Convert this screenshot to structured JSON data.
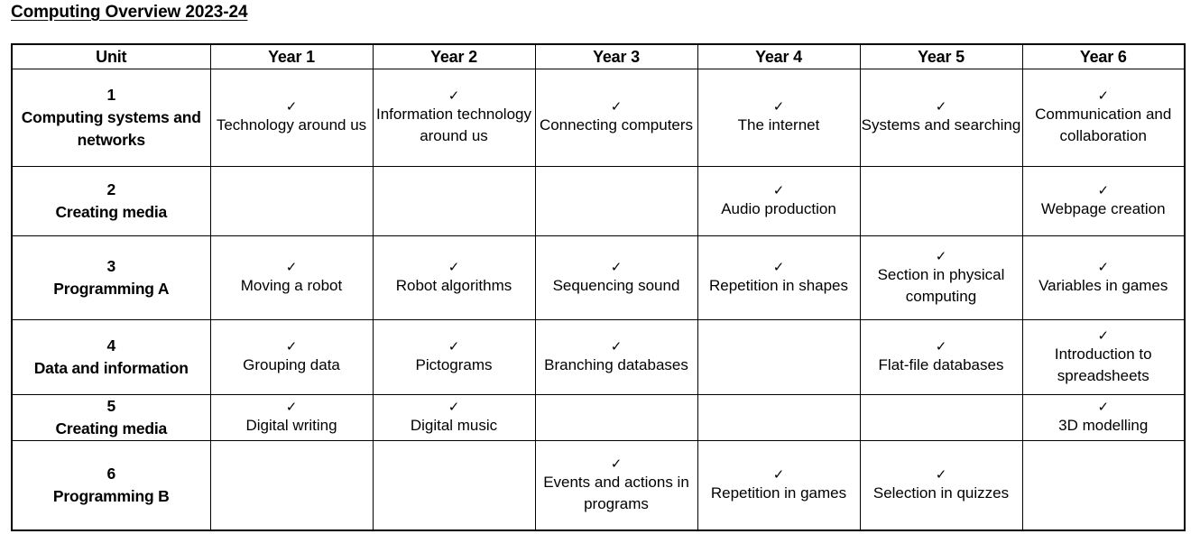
{
  "document": {
    "title": "Computing Overview 2023-24"
  },
  "table": {
    "headers": [
      "Unit",
      "Year 1",
      "Year 2",
      "Year 3",
      "Year 4",
      "Year 5",
      "Year 6"
    ],
    "tick_glyph": "✓",
    "rows": [
      {
        "unit_number": "1",
        "unit_name": "Computing systems and networks",
        "cells": [
          {
            "ticked": true,
            "text": "Technology around us"
          },
          {
            "ticked": true,
            "text": "Information technology around us"
          },
          {
            "ticked": true,
            "text": "Connecting computers"
          },
          {
            "ticked": true,
            "text": "The internet"
          },
          {
            "ticked": true,
            "text": "Systems and searching"
          },
          {
            "ticked": true,
            "text": "Communication and collaboration"
          }
        ]
      },
      {
        "unit_number": "2",
        "unit_name": "Creating media",
        "cells": [
          {
            "ticked": false,
            "text": ""
          },
          {
            "ticked": false,
            "text": ""
          },
          {
            "ticked": false,
            "text": ""
          },
          {
            "ticked": true,
            "text": "Audio production"
          },
          {
            "ticked": false,
            "text": ""
          },
          {
            "ticked": true,
            "text": "Webpage creation"
          }
        ]
      },
      {
        "unit_number": "3",
        "unit_name": "Programming A",
        "cells": [
          {
            "ticked": true,
            "text": "Moving a robot"
          },
          {
            "ticked": true,
            "text": "Robot algorithms"
          },
          {
            "ticked": true,
            "text": "Sequencing sound"
          },
          {
            "ticked": true,
            "text": "Repetition in shapes"
          },
          {
            "ticked": true,
            "text": "Section in physical computing"
          },
          {
            "ticked": true,
            "text": "Variables in games"
          }
        ]
      },
      {
        "unit_number": "4",
        "unit_name": "Data and information",
        "cells": [
          {
            "ticked": true,
            "text": "Grouping data"
          },
          {
            "ticked": true,
            "text": "Pictograms"
          },
          {
            "ticked": true,
            "text": "Branching databases"
          },
          {
            "ticked": false,
            "text": ""
          },
          {
            "ticked": true,
            "text": "Flat-file databases"
          },
          {
            "ticked": true,
            "text": "Introduction to spreadsheets"
          }
        ]
      },
      {
        "unit_number": "5",
        "unit_name": "Creating media",
        "cells": [
          {
            "ticked": true,
            "text": "Digital writing"
          },
          {
            "ticked": true,
            "text": "Digital music"
          },
          {
            "ticked": false,
            "text": ""
          },
          {
            "ticked": false,
            "text": ""
          },
          {
            "ticked": false,
            "text": ""
          },
          {
            "ticked": true,
            "text": "3D modelling"
          }
        ]
      },
      {
        "unit_number": "6",
        "unit_name": "Programming B",
        "cells": [
          {
            "ticked": false,
            "text": ""
          },
          {
            "ticked": false,
            "text": ""
          },
          {
            "ticked": true,
            "text": "Events and actions in programs"
          },
          {
            "ticked": true,
            "text": "Repetition in games"
          },
          {
            "ticked": true,
            "text": "Selection in quizzes"
          },
          {
            "ticked": false,
            "text": ""
          }
        ]
      }
    ]
  }
}
